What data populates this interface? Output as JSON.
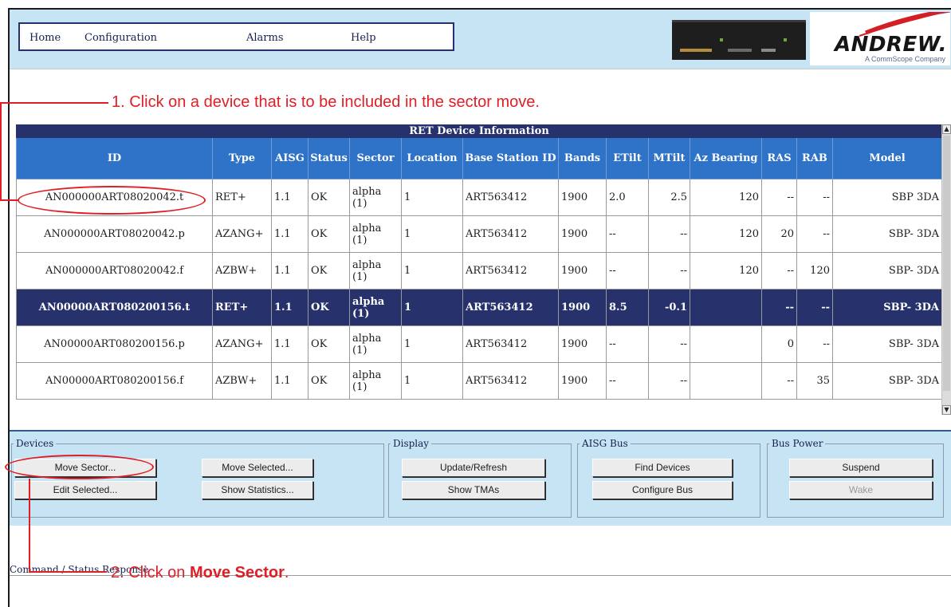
{
  "menu": {
    "items": [
      "Home",
      "Configuration",
      "Alarms",
      "Help"
    ]
  },
  "brand": {
    "name": "ANDREW.",
    "tagline": "A CommScope Company"
  },
  "annotations": {
    "step1": "1.  Click on a device that is to be included in the sector move.",
    "step2_prefix": "2.  Click on ",
    "step2_bold": "Move Sector",
    "step2_suffix": "."
  },
  "table": {
    "caption": "RET Device Information",
    "headers": [
      "ID",
      "Type",
      "AISG",
      "Status",
      "Sector",
      "Location",
      "Base Station ID",
      "Bands",
      "ETilt",
      "MTilt",
      "Az Bearing",
      "RAS",
      "RAB",
      "Model"
    ],
    "rows": [
      {
        "id": "AN000000ART08020042.t",
        "type": "RET+",
        "aisg": "1.1",
        "status": "OK",
        "sector": "alpha (1)",
        "location": "1",
        "bsid": "ART563412",
        "bands": "1900",
        "etilt": "2.0",
        "mtilt": "2.5",
        "az": "120",
        "ras": "--",
        "rab": "--",
        "model": "SBP 3DA",
        "selected": false
      },
      {
        "id": "AN000000ART08020042.p",
        "type": "AZANG+",
        "aisg": "1.1",
        "status": "OK",
        "sector": "alpha (1)",
        "location": "1",
        "bsid": "ART563412",
        "bands": "1900",
        "etilt": "--",
        "mtilt": "--",
        "az": "120",
        "ras": "20",
        "rab": "--",
        "model": "SBP- 3DA",
        "selected": false
      },
      {
        "id": "AN000000ART08020042.f",
        "type": "AZBW+",
        "aisg": "1.1",
        "status": "OK",
        "sector": "alpha (1)",
        "location": "1",
        "bsid": "ART563412",
        "bands": "1900",
        "etilt": "--",
        "mtilt": "--",
        "az": "120",
        "ras": "--",
        "rab": "120",
        "model": "SBP- 3DA",
        "selected": false
      },
      {
        "id": "AN00000ART080200156.t",
        "type": "RET+",
        "aisg": "1.1",
        "status": "OK",
        "sector": "alpha (1)",
        "location": "1",
        "bsid": "ART563412",
        "bands": "1900",
        "etilt": "8.5",
        "mtilt": "-0.1",
        "az": "",
        "ras": "--",
        "rab": "--",
        "model": "SBP- 3DA",
        "selected": true
      },
      {
        "id": "AN00000ART080200156.p",
        "type": "AZANG+",
        "aisg": "1.1",
        "status": "OK",
        "sector": "alpha (1)",
        "location": "1",
        "bsid": "ART563412",
        "bands": "1900",
        "etilt": "--",
        "mtilt": "--",
        "az": "",
        "ras": "0",
        "rab": "--",
        "model": "SBP- 3DA",
        "selected": false
      },
      {
        "id": "AN00000ART080200156.f",
        "type": "AZBW+",
        "aisg": "1.1",
        "status": "OK",
        "sector": "alpha (1)",
        "location": "1",
        "bsid": "ART563412",
        "bands": "1900",
        "etilt": "--",
        "mtilt": "--",
        "az": "",
        "ras": "--",
        "rab": "35",
        "model": "SBP- 3DA",
        "selected": false
      }
    ]
  },
  "groups": {
    "devices": {
      "label": "Devices",
      "move_sector": "Move Sector...",
      "move_selected": "Move Selected...",
      "edit_selected": "Edit Selected...",
      "show_statistics": "Show Statistics..."
    },
    "display": {
      "label": "Display",
      "update_refresh": "Update/Refresh",
      "show_tmas": "Show TMAs"
    },
    "aisg_bus": {
      "label": "AISG Bus",
      "find_devices": "Find Devices",
      "configure_bus": "Configure Bus"
    },
    "bus_power": {
      "label": "Bus Power",
      "suspend": "Suspend",
      "wake": "Wake"
    }
  },
  "status": {
    "label": "Command / Status Response"
  }
}
